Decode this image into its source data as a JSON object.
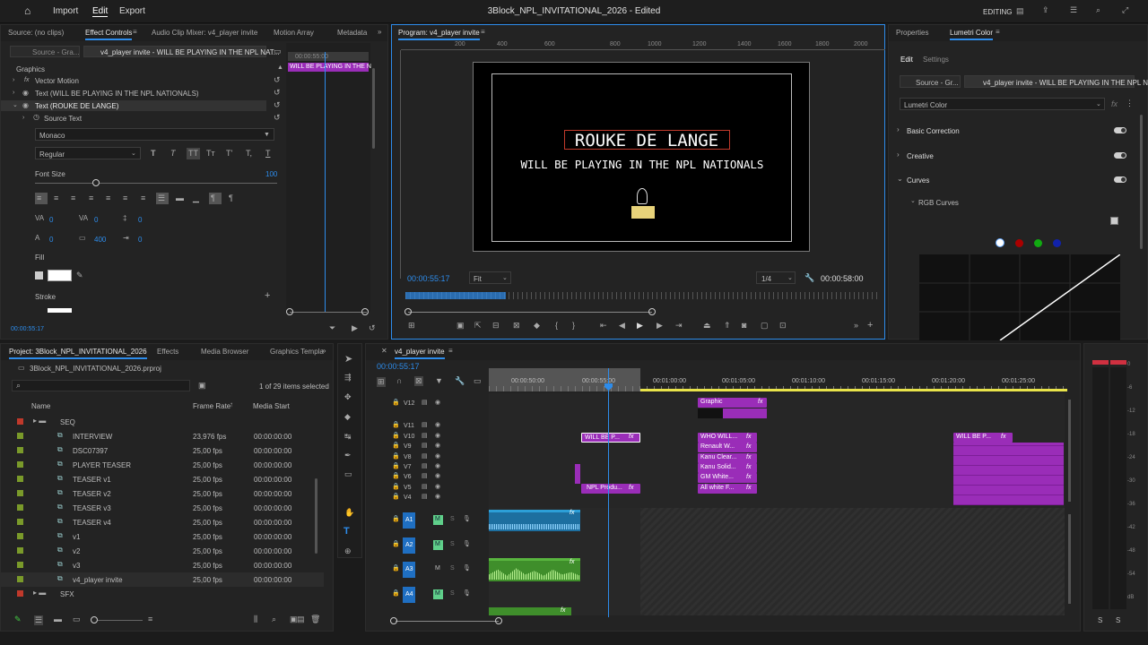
{
  "topbar": {
    "home_icon": "home-icon",
    "import": "Import",
    "edit": "Edit",
    "export": "Export",
    "title": "3Block_NPL_INVITATIONAL_2026 - Edited",
    "workspace": "EDITING"
  },
  "effect_controls": {
    "tabs": [
      "Source: (no clips)",
      "Effect Controls",
      "Audio Clip Mixer: v4_player invite",
      "Motion Array",
      "Metadata"
    ],
    "source_dropdown": "Source - Gra...",
    "clip_dropdown": "v4_player invite - WILL BE PLAYING IN THE NPL NAT...",
    "mini_timecode": "00:00:55:00",
    "mini_clip": "WILL BE PLAYING IN THE N",
    "section": "Graphics",
    "vector_motion": "Vector Motion",
    "text1": "Text (WILL BE PLAYING IN THE NPL NATIONALS)",
    "text2": "Text (ROUKE DE LANGE)",
    "source_text": "Source Text",
    "font": "Monaco",
    "style": "Regular",
    "font_size_label": "Font Size",
    "font_size": "100",
    "kern": "0",
    "track": "0",
    "lead": "0",
    "baseline": "0",
    "tsume": "400",
    "indent": "0",
    "fill": "Fill",
    "stroke": "Stroke",
    "timecode": "00:00:55:17"
  },
  "program": {
    "tab": "Program: v4_player invite",
    "ruler": [
      "200",
      "400",
      "600",
      "800",
      "1000",
      "1200",
      "1400",
      "1600",
      "1800",
      "2000"
    ],
    "title": "ROUKE DE LANGE",
    "subtitle": "WILL BE PLAYING IN THE NPL NATIONALS",
    "timecode": "00:00:55:17",
    "fit": "Fit",
    "quality": "1/4",
    "duration": "00:00:58:00"
  },
  "lumetri": {
    "tabs": [
      "Properties",
      "Lumetri Color"
    ],
    "subtabs": [
      "Edit",
      "Settings"
    ],
    "source_dropdown": "Source - Gr...",
    "clip_dropdown": "v4_player invite - WILL BE PLAYING IN THE NPL N...",
    "effect": "Lumetri Color",
    "sections": [
      "Basic Correction",
      "Creative",
      "Curves"
    ],
    "rgb_curves": "RGB Curves"
  },
  "project": {
    "tabs": [
      "Project: 3Block_NPL_INVITATIONAL_2026",
      "Effects",
      "Media Browser",
      "Graphics Templa"
    ],
    "file": "3Block_NPL_INVITATIONAL_2026.prproj",
    "selection": "1 of 29 items selected",
    "columns": [
      "Name",
      "Frame Rate",
      "Media Start"
    ],
    "items": [
      {
        "name": "SEQ",
        "rate": "",
        "start": "",
        "color": "#c0392b",
        "folder": true
      },
      {
        "name": "INTERVIEW",
        "rate": "23,976 fps",
        "start": "00:00:00:00",
        "color": "#7a9a2a"
      },
      {
        "name": "DSC07397",
        "rate": "25,00 fps",
        "start": "00:00:00:00",
        "color": "#7a9a2a"
      },
      {
        "name": "PLAYER TEASER",
        "rate": "25,00 fps",
        "start": "00:00:00:00",
        "color": "#7a9a2a"
      },
      {
        "name": "TEASER v1",
        "rate": "25,00 fps",
        "start": "00:00:00:00",
        "color": "#7a9a2a"
      },
      {
        "name": "TEASER v2",
        "rate": "25,00 fps",
        "start": "00:00:00:00",
        "color": "#7a9a2a"
      },
      {
        "name": "TEASER v3",
        "rate": "25,00 fps",
        "start": "00:00:00:00",
        "color": "#7a9a2a"
      },
      {
        "name": "TEASER v4",
        "rate": "25,00 fps",
        "start": "00:00:00:00",
        "color": "#7a9a2a"
      },
      {
        "name": "v1",
        "rate": "25,00 fps",
        "start": "00:00:00:00",
        "color": "#7a9a2a"
      },
      {
        "name": "v2",
        "rate": "25,00 fps",
        "start": "00:00:00:00",
        "color": "#7a9a2a"
      },
      {
        "name": "v3",
        "rate": "25,00 fps",
        "start": "00:00:00:00",
        "color": "#7a9a2a"
      },
      {
        "name": "v4_player invite",
        "rate": "25,00 fps",
        "start": "00:00:00:00",
        "color": "#7a9a2a"
      },
      {
        "name": "SFX",
        "rate": "",
        "start": "",
        "color": "#c0392b",
        "folder": true
      }
    ]
  },
  "timeline": {
    "tab": "v4_player invite",
    "timecode": "00:00:55:17",
    "ruler": [
      "00:00:50:00",
      "00:00:55:00",
      "00:01:00:00",
      "00:01:05:00",
      "00:01:10:00",
      "00:01:15:00",
      "00:01:20:00",
      "00:01:25:00"
    ],
    "video_tracks": [
      "V12",
      "V11",
      "V10",
      "V9",
      "V8",
      "V7",
      "V6",
      "V5",
      "V4"
    ],
    "audio_tracks": [
      "A1",
      "A2",
      "A3",
      "A4"
    ],
    "clips": {
      "graphic": "Graphic",
      "will_be": "WILL BE P...",
      "who": "WHO WILL...",
      "renault": "Renault W...",
      "kanu_clear": "Kanu Clear...",
      "kanu_solid": "Kanu Solid...",
      "gm": "GM White...",
      "all_white": "All white F...",
      "npl": "NPL Produ...",
      "will_be2": "WILL BE P...",
      "fx": "fx"
    }
  },
  "meter": {
    "labels": [
      "0",
      "-6",
      "-12",
      "-18",
      "-24",
      "-30",
      "-36",
      "-42",
      "-48",
      "-54",
      "dB"
    ],
    "solo": "S"
  }
}
